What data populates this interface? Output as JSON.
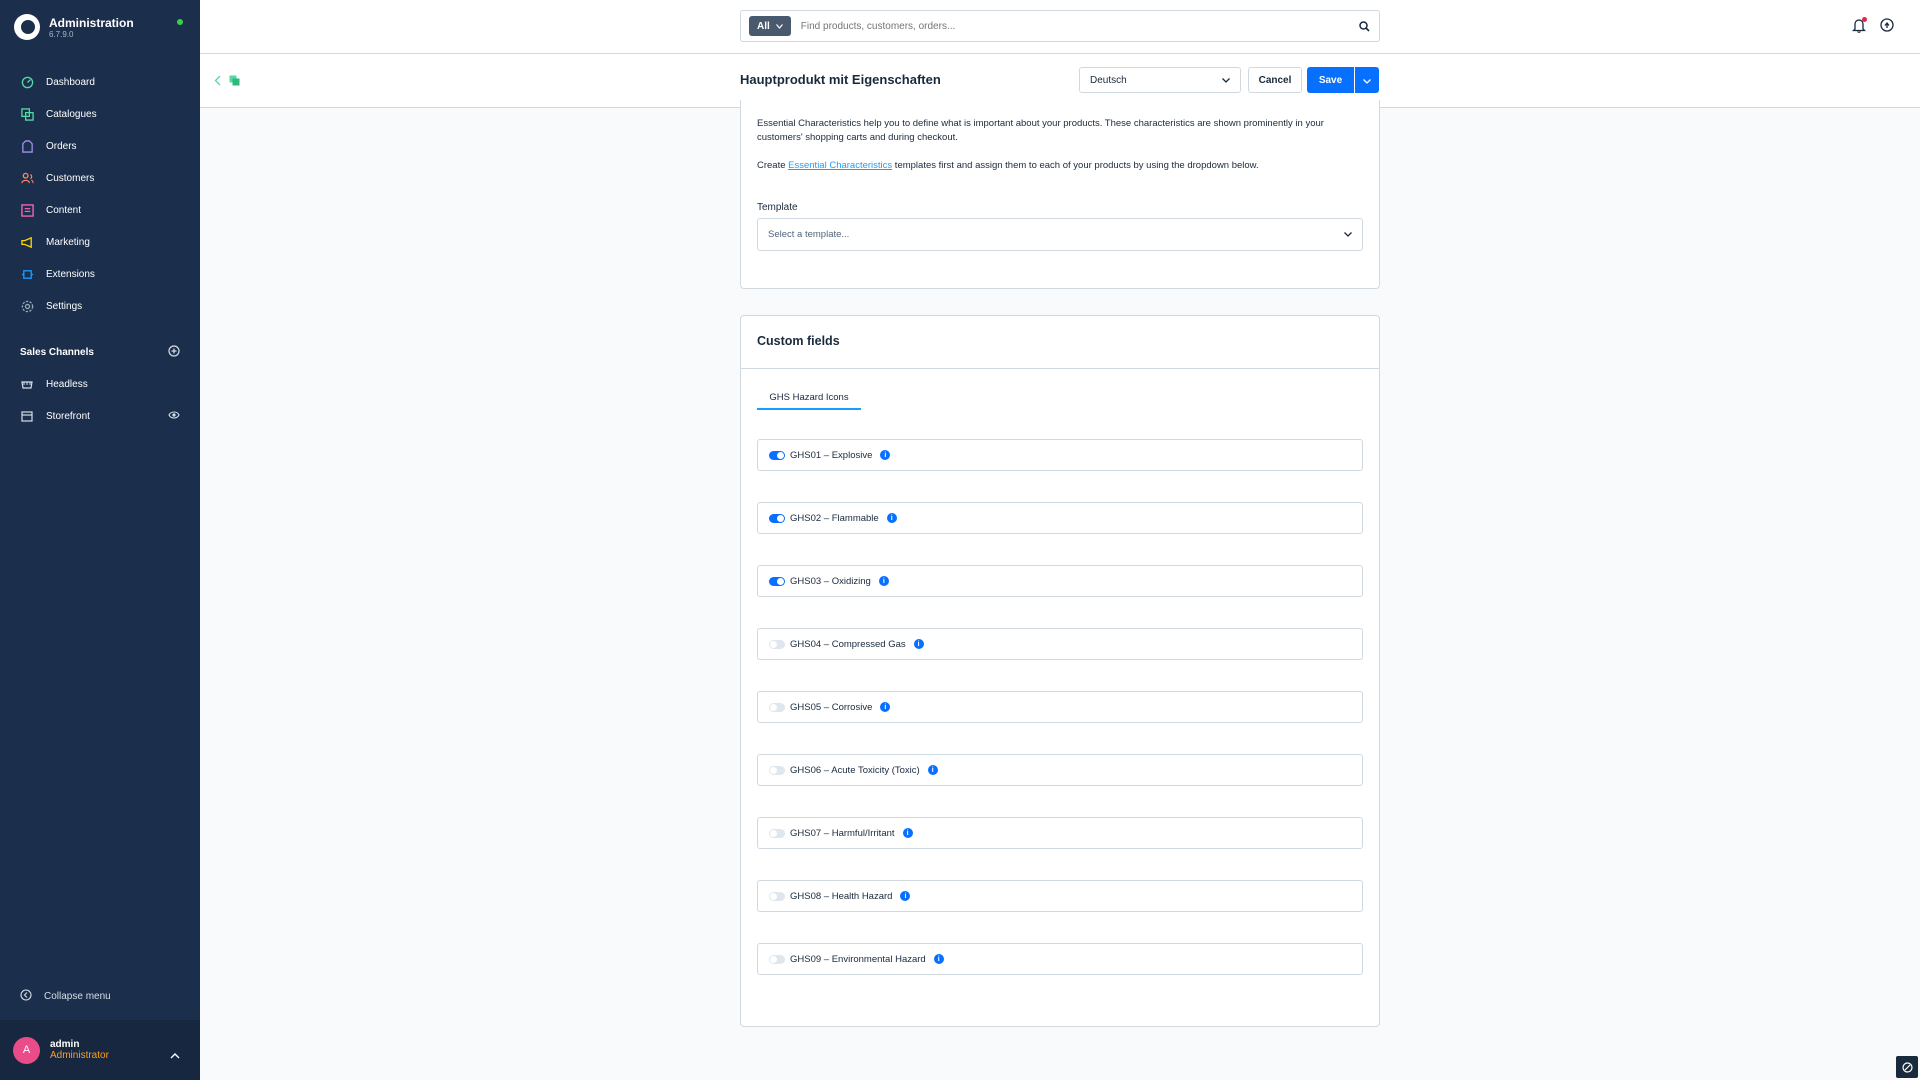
{
  "app": {
    "title": "Administration",
    "version": "6.7.9.0"
  },
  "nav": [
    {
      "label": "Dashboard",
      "icon": "dashboard-icon",
      "color": "#57d9a3"
    },
    {
      "label": "Catalogues",
      "icon": "catalogue-icon",
      "color": "#57d9a3"
    },
    {
      "label": "Orders",
      "icon": "orders-icon",
      "color": "#a092f0"
    },
    {
      "label": "Customers",
      "icon": "customers-icon",
      "color": "#f88962"
    },
    {
      "label": "Content",
      "icon": "content-icon",
      "color": "#ff68b4"
    },
    {
      "label": "Marketing",
      "icon": "marketing-icon",
      "color": "#ffd700"
    },
    {
      "label": "Extensions",
      "icon": "extensions-icon",
      "color": "#189eff"
    },
    {
      "label": "Settings",
      "icon": "settings-icon",
      "color": "#9aa8b5"
    }
  ],
  "sales_channels": {
    "header": "Sales Channels",
    "items": [
      {
        "label": "Headless",
        "icon": "basket-icon"
      },
      {
        "label": "Storefront",
        "icon": "storefront-icon"
      }
    ]
  },
  "sidebar_footer": {
    "collapse_label": "Collapse menu"
  },
  "user": {
    "initial": "A",
    "name": "admin",
    "role": "Administrator"
  },
  "search": {
    "type_label": "All",
    "placeholder": "Find products, customers, orders..."
  },
  "smartbar": {
    "title": "Hauptprodukt mit Eigenschaften",
    "language": "Deutsch",
    "cancel_label": "Cancel",
    "save_label": "Save"
  },
  "essential": {
    "description": "Essential Characteristics help you to define what is important about your products. These characteristics are shown prominently in your customers' shopping carts and during checkout.",
    "create_prefix": "Create ",
    "create_link": "Essential Characteristics",
    "create_suffix": " templates first and assign them to each of your products by using the dropdown below.",
    "template_label": "Template",
    "template_placeholder": "Select a template..."
  },
  "custom_fields": {
    "title": "Custom fields",
    "tab": "GHS Hazard Icons",
    "fields": [
      {
        "label": "GHS01 – Explosive",
        "enabled": true
      },
      {
        "label": "GHS02 – Flammable",
        "enabled": true
      },
      {
        "label": "GHS03 – Oxidizing",
        "enabled": true
      },
      {
        "label": "GHS04 – Compressed Gas",
        "enabled": false
      },
      {
        "label": "GHS05 – Corrosive",
        "enabled": false
      },
      {
        "label": "GHS06 – Acute Toxicity (Toxic)",
        "enabled": false
      },
      {
        "label": "GHS07 – Harmful/Irritant",
        "enabled": false
      },
      {
        "label": "GHS08 – Health Hazard",
        "enabled": false
      },
      {
        "label": "GHS09 – Environmental Hazard",
        "enabled": false
      }
    ]
  },
  "colors": {
    "primary": "#0870ff",
    "sidebar": "#1b2f4c",
    "link": "#189eff"
  }
}
